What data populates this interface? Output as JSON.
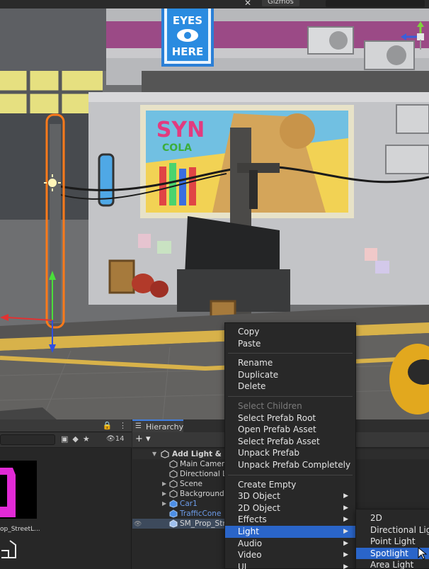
{
  "scene_toolbar": {
    "close_glyph": "✕",
    "gizmos_label": "Gizmos"
  },
  "scene_signs": {
    "eyes_top": "EYES",
    "eyes_bottom": "HERE",
    "syn": "SYN",
    "cola": "COLA"
  },
  "context_menu": {
    "items": [
      {
        "label": "Copy"
      },
      {
        "label": "Paste"
      },
      {
        "label": "Rename"
      },
      {
        "label": "Duplicate"
      },
      {
        "label": "Delete"
      },
      {
        "label": "Select Children"
      },
      {
        "label": "Select Prefab Root"
      },
      {
        "label": "Open Prefab Asset"
      },
      {
        "label": "Select Prefab Asset"
      },
      {
        "label": "Unpack Prefab"
      },
      {
        "label": "Unpack Prefab Completely"
      },
      {
        "label": "Create Empty"
      },
      {
        "label": "3D Object"
      },
      {
        "label": "2D Object"
      },
      {
        "label": "Effects"
      },
      {
        "label": "Light"
      },
      {
        "label": "Audio"
      },
      {
        "label": "Video"
      },
      {
        "label": "UI"
      }
    ]
  },
  "light_submenu": {
    "items": [
      {
        "label": "2D"
      },
      {
        "label": "Directional Light"
      },
      {
        "label": "Point Light"
      },
      {
        "label": "Spotlight"
      },
      {
        "label": "Area Light"
      }
    ]
  },
  "project": {
    "count": "14",
    "asset_label": "op_StreetL..."
  },
  "hierarchy": {
    "tab_label": "Hierarchy",
    "add_label": "+ ▾",
    "rows": [
      {
        "label": "Add Light & Pr"
      },
      {
        "label": "Main Camera"
      },
      {
        "label": "Directional Li"
      },
      {
        "label": "Scene"
      },
      {
        "label": "Background"
      },
      {
        "label": "Car1"
      },
      {
        "label": "TrafficCone"
      },
      {
        "label": "SM_Prop_Stre"
      }
    ]
  },
  "colors": {
    "menu_highlight": "#2a65c9",
    "selection_outline": "#ff7a1a",
    "prefab_blue": "#6c9be8"
  }
}
